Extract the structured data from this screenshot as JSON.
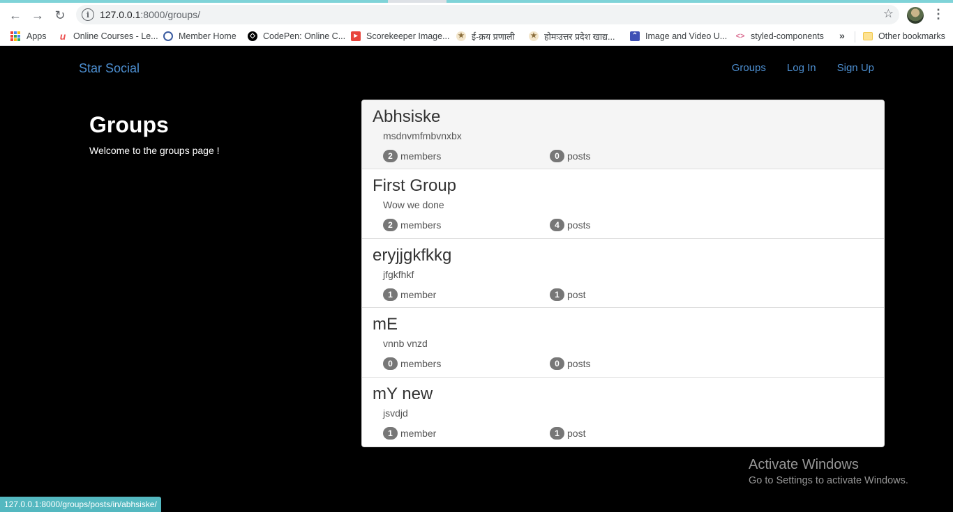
{
  "browser": {
    "url_host": "127.0.0.1",
    "url_path": ":8000/groups/",
    "status_url": "127.0.0.1:8000/groups/posts/in/abhsiske/",
    "bookmarks": [
      {
        "label": "Apps",
        "icon": "apps-grid-icon"
      },
      {
        "label": "Online Courses - Le...",
        "icon": "udemy-icon",
        "color": "#ec5252"
      },
      {
        "label": "Member Home",
        "icon": "member-home-icon",
        "color": "#3a5ba0"
      },
      {
        "label": "CodePen: Online C...",
        "icon": "codepen-icon",
        "color": "#000000"
      },
      {
        "label": "Scorekeeper Image...",
        "icon": "scorekeeper-icon",
        "color": "#e8453c"
      },
      {
        "label": "ई-क्रय प्रणाली",
        "icon": "emblem-icon",
        "color": "#8a6d3b"
      },
      {
        "label": "होमःउत्तर प्रदेश खाद्य...",
        "icon": "emblem-icon",
        "color": "#8a6d3b"
      },
      {
        "label": "Image and Video U...",
        "icon": "image-upload-icon",
        "color": "#3f51b5"
      },
      {
        "label": "styled-components",
        "icon": "styled-components-icon",
        "color": "#db7093"
      }
    ],
    "more_label": "»",
    "other_bookmarks": "Other bookmarks"
  },
  "site": {
    "brand": "Star Social",
    "nav": [
      "Groups",
      "Log In",
      "Sign Up"
    ],
    "heading": "Groups",
    "welcome": "Welcome to the groups page !",
    "accent_color": "#4d8fd1"
  },
  "groups": [
    {
      "name": "Abhsiske",
      "description": "msdnvmfmbvnxbx",
      "members_count": "2",
      "members_label": "members",
      "posts_count": "0",
      "posts_label": "posts"
    },
    {
      "name": "First Group",
      "description": "Wow we done",
      "members_count": "2",
      "members_label": "members",
      "posts_count": "4",
      "posts_label": "posts"
    },
    {
      "name": "eryjjgkfkkg",
      "description": "jfgkfhkf",
      "members_count": "1",
      "members_label": "member",
      "posts_count": "1",
      "posts_label": "post"
    },
    {
      "name": "mE",
      "description": "vnnb vnzd",
      "members_count": "0",
      "members_label": "members",
      "posts_count": "0",
      "posts_label": "posts"
    },
    {
      "name": "mY new",
      "description": "jsvdjd",
      "members_count": "1",
      "members_label": "member",
      "posts_count": "1",
      "posts_label": "post"
    }
  ],
  "watermark": {
    "line1": "Activate Windows",
    "line2": "Go to Settings to activate Windows."
  }
}
